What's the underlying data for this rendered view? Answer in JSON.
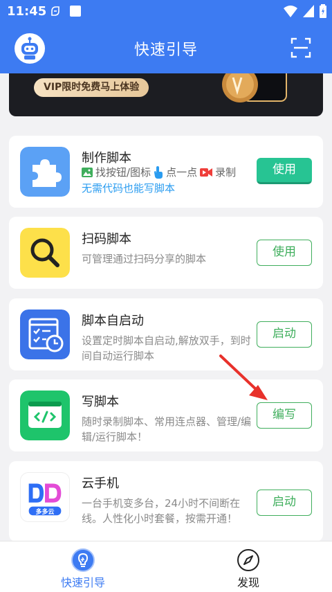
{
  "status": {
    "time": "11:45"
  },
  "appbar": {
    "title": "快速引导"
  },
  "banner": {
    "pill": "VIP限时免费马上体验"
  },
  "cards": [
    {
      "title": "制作脚本",
      "features": [
        "找按钮/图标",
        "点一点",
        "录制"
      ],
      "subtitle": "无需代码也能写脚本",
      "button": "使用"
    },
    {
      "title": "扫码脚本",
      "desc": "可管理通过扫码分享的脚本",
      "button": "使用"
    },
    {
      "title": "脚本自启动",
      "desc": "设置定时脚本自启动,解放双手，到时间自动运行脚本",
      "button": "启动"
    },
    {
      "title": "写脚本",
      "desc": "随时录制脚本、常用连点器、管理/编辑/运行脚本！",
      "button": "编写"
    },
    {
      "title": "云手机",
      "desc": "一台手机变多台，24小时不间断在线。人性化小时套餐，按需开通！",
      "button": "启动",
      "icon_label": "多多云"
    }
  ],
  "nav": [
    {
      "label": "快速引导",
      "active": true
    },
    {
      "label": "发现",
      "active": false
    }
  ],
  "colors": {
    "primary": "#3d7bf2",
    "button_green": "#3fae5c",
    "filled_button": "#27c493",
    "accent_blue": "#2a9cf0"
  }
}
